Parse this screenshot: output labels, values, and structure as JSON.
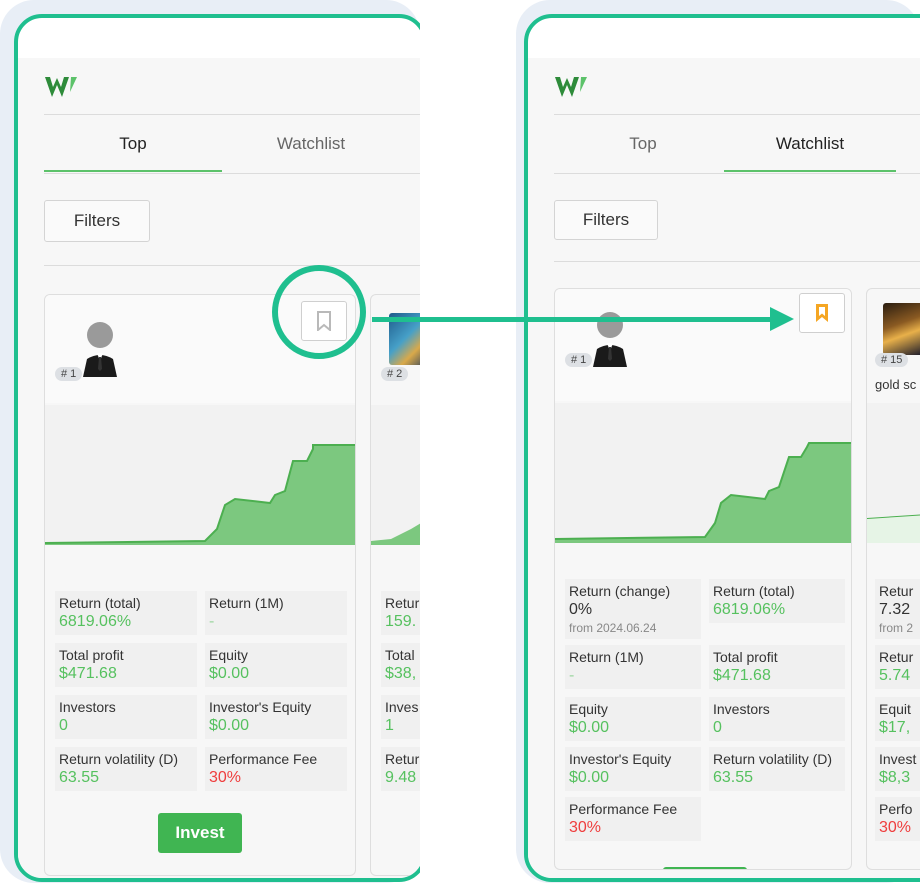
{
  "left": {
    "tabs": [
      {
        "label": "Top",
        "active": true
      },
      {
        "label": "Watchlist",
        "active": false
      }
    ],
    "filters_label": "Filters",
    "card": {
      "rank": "# 1",
      "bookmarked": false,
      "stats": [
        {
          "label": "Return (total)",
          "value": "6819.06%",
          "tone": "green"
        },
        {
          "label": "Return (1M)",
          "value": "-",
          "tone": "dash"
        },
        {
          "label": "Total profit",
          "value": "$471.68",
          "tone": "green"
        },
        {
          "label": "Equity",
          "value": "$0.00",
          "tone": "green"
        },
        {
          "label": "Investors",
          "value": "0",
          "tone": "green"
        },
        {
          "label": "Investor's Equity",
          "value": "$0.00",
          "tone": "green"
        },
        {
          "label": "Return volatility (D)",
          "value": "63.55",
          "tone": "green"
        },
        {
          "label": "Performance Fee",
          "value": "30%",
          "tone": "red"
        }
      ],
      "invest_label": "Invest"
    },
    "peek_card": {
      "rank": "# 2",
      "stats": [
        {
          "label": "Retur",
          "value": "159.",
          "tone": "green"
        },
        {
          "label": "Total",
          "value": "$38,",
          "tone": "green"
        },
        {
          "label": "Inves",
          "value": "1",
          "tone": "green"
        },
        {
          "label": "Retur",
          "value": "9.48",
          "tone": "green"
        }
      ]
    }
  },
  "right": {
    "tabs": [
      {
        "label": "Top",
        "active": false
      },
      {
        "label": "Watchlist",
        "active": true
      }
    ],
    "filters_label": "Filters",
    "card": {
      "rank": "# 1",
      "bookmarked": true,
      "stats": [
        {
          "label": "Return (change)",
          "value": "0%",
          "sub": "from 2024.06.24",
          "tone": "dark"
        },
        {
          "label": "Return (total)",
          "value": "6819.06%",
          "tone": "green"
        },
        {
          "label": "Return (1M)",
          "value": "-",
          "tone": "dash"
        },
        {
          "label": "Total profit",
          "value": "$471.68",
          "tone": "green"
        },
        {
          "label": "Equity",
          "value": "$0.00",
          "tone": "green"
        },
        {
          "label": "Investors",
          "value": "0",
          "tone": "green"
        },
        {
          "label": "Investor's Equity",
          "value": "$0.00",
          "tone": "green"
        },
        {
          "label": "Return volatility (D)",
          "value": "63.55",
          "tone": "green"
        },
        {
          "label": "Performance Fee",
          "value": "30%",
          "tone": "red"
        }
      ]
    },
    "peek_card": {
      "rank": "# 15",
      "name": "gold sc",
      "stats": [
        {
          "label": "Retur",
          "value": "7.32",
          "sub": "from 2",
          "tone": "dark"
        },
        {
          "label": "Retur",
          "value": "5.74",
          "tone": "green"
        },
        {
          "label": "Equit",
          "value": "$17,",
          "tone": "green"
        },
        {
          "label": "Invest",
          "value": "$8,3",
          "tone": "green"
        },
        {
          "label": "Perfo",
          "value": "30%",
          "tone": "red"
        }
      ]
    }
  },
  "colors": {
    "accent": "#1fbf8f",
    "green": "#56c15f",
    "red": "#ef3d3d",
    "bookmark_active": "#f5a623",
    "chart_fill": "#7cc87f"
  },
  "icons": [
    "logo-icon",
    "bookmark-icon",
    "user-avatar-icon"
  ]
}
